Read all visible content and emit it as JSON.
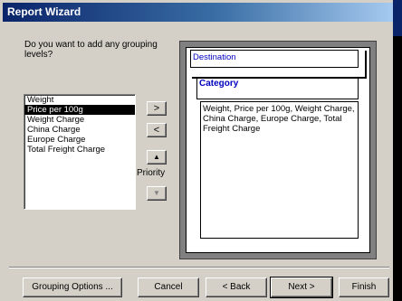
{
  "window": {
    "title": "Report Wizard"
  },
  "prompt": "Do you want to add any grouping levels?",
  "fields_list": {
    "items": [
      "Weight",
      "Price per 100g",
      "Weight Charge",
      "China Charge",
      "Europe Charge",
      "Total Freight Charge"
    ],
    "selected_index": 1
  },
  "move_buttons": {
    "add": ">",
    "remove": "<",
    "priority_up": "▲",
    "priority_down": "▼",
    "priority_label": "Priority"
  },
  "preview": {
    "destination": "Destination",
    "category": "Category",
    "fields": "Weight, Price per 100g, Weight Charge, China Charge, Europe Charge, Total Freight Charge"
  },
  "buttons": {
    "grouping_options": "Grouping Options ...",
    "cancel": "Cancel",
    "back": "< Back",
    "next": "Next >",
    "finish": "Finish"
  }
}
